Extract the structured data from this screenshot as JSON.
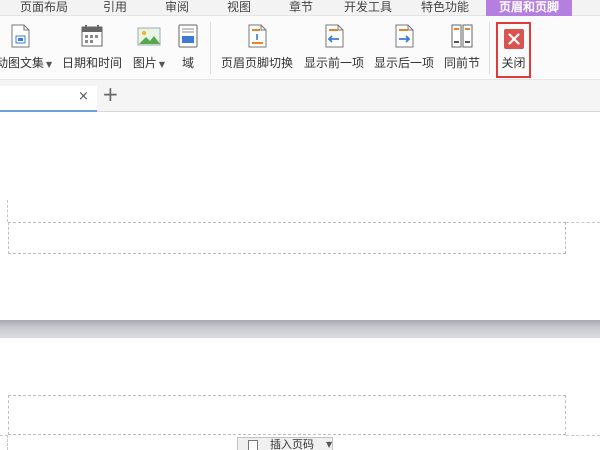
{
  "menu_tabs": [
    "页面布局",
    "引用",
    "审阅",
    "视图",
    "章节",
    "开发工具",
    "特色功能",
    "页眉和页脚"
  ],
  "ribbon": {
    "buttons": [
      {
        "label": "动图文集",
        "icon": "doc-field-icon",
        "dropdown": true
      },
      {
        "label": "日期和时间",
        "icon": "calendar-icon"
      },
      {
        "label": "图片",
        "icon": "picture-icon",
        "dropdown": true
      },
      {
        "label": "域",
        "icon": "field-icon"
      },
      {
        "label": "页眉页脚切换",
        "icon": "header-footer-switch-icon"
      },
      {
        "label": "显示前一项",
        "icon": "show-previous-icon"
      },
      {
        "label": "显示后一项",
        "icon": "show-next-icon"
      },
      {
        "label": "同前节",
        "icon": "same-as-previous-icon"
      },
      {
        "label": "关闭",
        "icon": "close-icon"
      }
    ]
  },
  "doc_tab": {
    "close": "×",
    "add": "+"
  },
  "footer_bar": {
    "insert_page_number": "插入页码"
  },
  "colors": {
    "active_tab": "#b57fe0",
    "close_red": "#d9534f",
    "highlight_frame": "#e03a3a",
    "tab_accent": "#6c9fe0"
  }
}
